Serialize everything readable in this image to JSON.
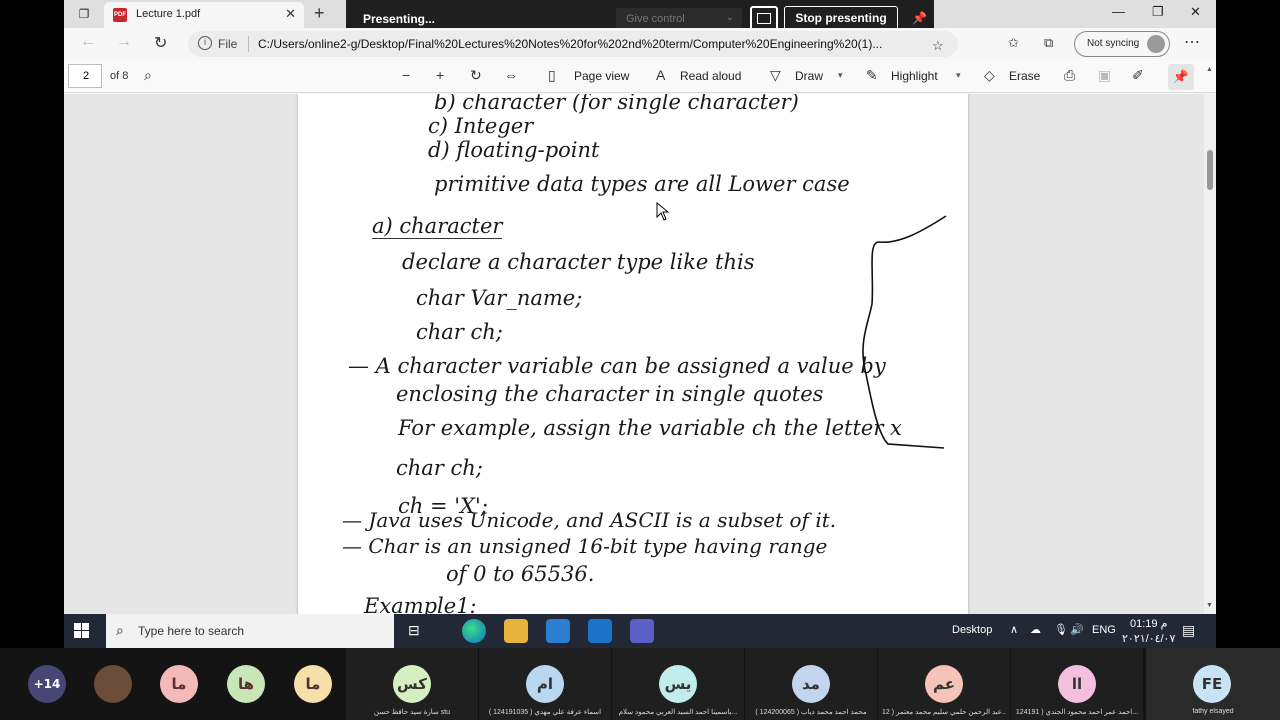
{
  "browser": {
    "tab_title": "Lecture 1.pdf",
    "file_label": "File",
    "url": "C:/Users/online2-g/Desktop/Final%20Lectures%20Notes%20for%202nd%20term/Computer%20Engineering%20(1)...",
    "sync_label": "Not syncing"
  },
  "presenting": {
    "status": "Presenting...",
    "give_control": "Give control",
    "stop": "Stop presenting"
  },
  "pdf_toolbar": {
    "page_number": "2",
    "page_total": "of 8",
    "page_view": "Page view",
    "read_aloud": "Read aloud",
    "draw": "Draw",
    "highlight": "Highlight",
    "erase": "Erase"
  },
  "document": {
    "lines": [
      "b) character (for single character)",
      "c) Integer",
      "d) floating-point",
      "primitive data types are all Lower case",
      "a) character",
      "declare a character type like this",
      "char Var_name;",
      "char ch;",
      "— A character variable can be assigned a value by",
      "enclosing the character in single quotes",
      "For example, assign the variable ch the letter x",
      "char ch;",
      "ch = 'X';",
      "— Java uses Unicode, and ASCII is a subset of it.",
      "— Char is an unsigned 16-bit type having range",
      "of 0 to 65536.",
      "Example1:"
    ]
  },
  "taskbar": {
    "search_placeholder": "Type here to search",
    "desktop_label": "Desktop",
    "lang": "ENG",
    "time": "01:19 م",
    "date": "٢٠٢١/٠٤/٠٧"
  },
  "participants": {
    "overflow": "+14",
    "small": [
      {
        "initials": "ما",
        "color": "#f4b9b9"
      },
      {
        "initials": "ها",
        "color": "#c9e6b7"
      },
      {
        "initials": "ما",
        "color": "#f6dfa8"
      }
    ],
    "tiles": [
      {
        "initials": "كس",
        "name": "سارة سيد حافظ حسن stu",
        "color": "#d5efc0"
      },
      {
        "initials": "ام",
        "name": "اسماء عرفة علي مهدي ( 124191035 )",
        "color": "#b9d7f0"
      },
      {
        "initials": "يس",
        "name": "ياسمينا احمد السيد العربي محمود سلام...",
        "color": "#c0ecec"
      },
      {
        "initials": "مد",
        "name": "محمد احمد محمد دياب ( 124200065 )",
        "color": "#c3d4ee"
      },
      {
        "initials": "عم",
        "name": "عبد الرحمن حلمي سليم محمد معتمر ( 12...",
        "color": "#f6c3b8"
      },
      {
        "initials": "اا",
        "name": "احمد عمر احمد محمود الجندي ( 124191...",
        "color": "#f4bede"
      },
      {
        "initials": "FE",
        "name": "fathy elsayed",
        "color": "#c8e3f4"
      }
    ]
  }
}
